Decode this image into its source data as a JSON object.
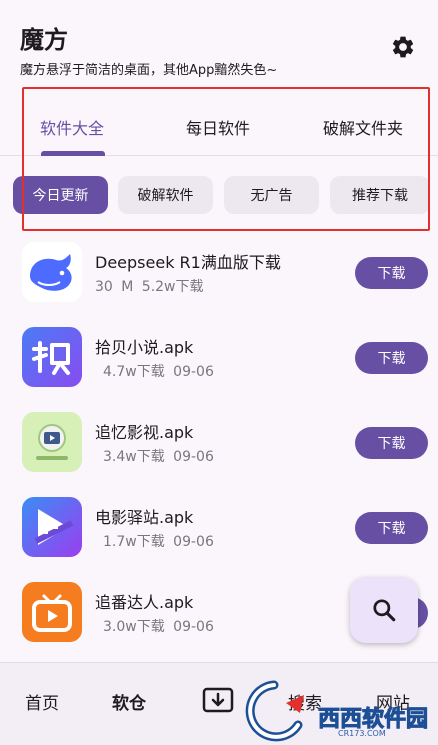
{
  "header": {
    "title": "魔方",
    "subtitle": "魔方悬浮于简洁的桌面，其他App黯然失色~",
    "settings_icon": "gear-icon"
  },
  "tabs": [
    {
      "label": "软件大全",
      "active": true
    },
    {
      "label": "每日软件",
      "active": false
    },
    {
      "label": "破解文件夹",
      "active": false
    }
  ],
  "chips": [
    {
      "label": "今日更新",
      "active": true
    },
    {
      "label": "破解软件",
      "active": false
    },
    {
      "label": "无广告",
      "active": false
    },
    {
      "label": "推荐下载",
      "active": false
    }
  ],
  "apps": [
    {
      "name": "Deepseek R1满血版下载",
      "meta": "30 M  5.2w下载",
      "button": "下载",
      "icon": "deepseek-whale-icon"
    },
    {
      "name": "拾贝小说.apk",
      "meta": "4.7w下载  09-06",
      "button": "下载",
      "icon": "shibei-novel-icon"
    },
    {
      "name": "追忆影视.apk",
      "meta": "3.4w下载  09-06",
      "button": "下载",
      "icon": "zhuiyi-video-icon"
    },
    {
      "name": "电影驿站.apk",
      "meta": "1.7w下载  09-06",
      "button": "下载",
      "icon": "film-station-icon"
    },
    {
      "name": "追番达人.apk",
      "meta": "3.0w下载  09-06",
      "button": "下载",
      "icon": "tv-anime-icon"
    }
  ],
  "fab": {
    "icon": "search-icon"
  },
  "bottom_nav": [
    {
      "label": "首页",
      "active": false
    },
    {
      "label": "软仓",
      "active": true
    },
    {
      "label": "",
      "icon": "download-box-icon",
      "active": false
    },
    {
      "label": "搜索",
      "active": false
    },
    {
      "label": "网站",
      "active": false
    }
  ],
  "watermark": {
    "text": "西西软件园",
    "sub": "CR173.COM"
  },
  "colors": {
    "accent": "#6750a4",
    "highlight": "#e4302c",
    "background": "#fbf6fc"
  }
}
